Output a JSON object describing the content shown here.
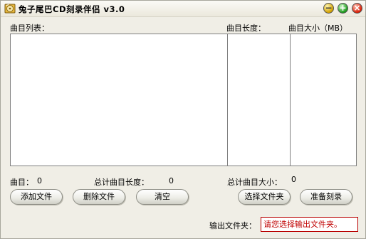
{
  "window": {
    "title": "兔子尾巴CD刻录伴侣 v3.0",
    "controls": {
      "minimize": "−",
      "maximize": "+",
      "close": "×"
    }
  },
  "headers": {
    "track_list": "曲目列表：",
    "track_length": "曲目长度：",
    "track_size": "曲目大小（MB）"
  },
  "tracks": [],
  "stats": {
    "count_label": "曲目：",
    "count_value": "0",
    "total_length_label": "总计曲目长度：",
    "total_length_value": "0",
    "total_size_label": "总计曲目大小：",
    "total_size_value": "0"
  },
  "buttons": {
    "add_file": "添加文件",
    "remove_file": "删除文件",
    "clear": "清空",
    "select_folder": "选择文件夹",
    "prepare_burn": "准备刻录"
  },
  "output": {
    "label": "输出文件夹：",
    "value": "请您选择输出文件夹。",
    "value_color": "#c00000"
  }
}
